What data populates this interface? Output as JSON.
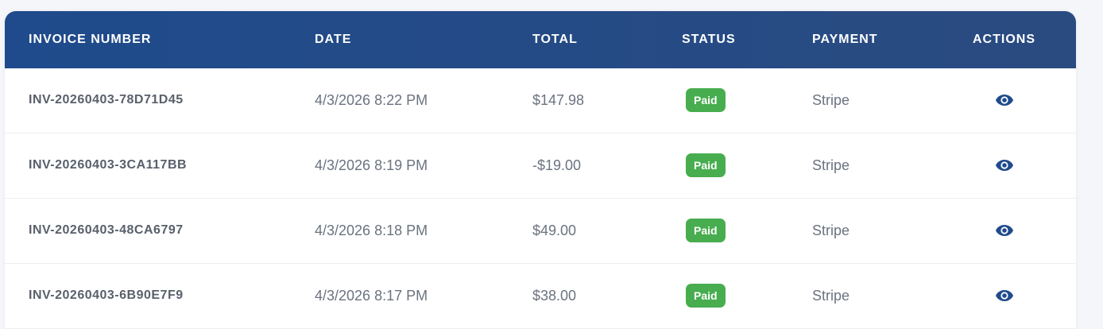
{
  "table": {
    "headers": {
      "invoice_number": "INVOICE NUMBER",
      "date": "DATE",
      "total": "TOTAL",
      "status": "STATUS",
      "payment": "PAYMENT",
      "actions": "ACTIONS"
    },
    "rows": [
      {
        "invoice": "INV-20260403-78D71D45",
        "date": "4/3/2026 8:22 PM",
        "total": "$147.98",
        "status": "Paid",
        "payment": "Stripe",
        "action_icon": "eye-icon"
      },
      {
        "invoice": "INV-20260403-3CA117BB",
        "date": "4/3/2026 8:19 PM",
        "total": "-$19.00",
        "status": "Paid",
        "payment": "Stripe",
        "action_icon": "eye-icon"
      },
      {
        "invoice": "INV-20260403-48CA6797",
        "date": "4/3/2026 8:18 PM",
        "total": "$49.00",
        "status": "Paid",
        "payment": "Stripe",
        "action_icon": "eye-icon"
      },
      {
        "invoice": "INV-20260403-6B90E7F9",
        "date": "4/3/2026 8:17 PM",
        "total": "$38.00",
        "status": "Paid",
        "payment": "Stripe",
        "action_icon": "eye-icon"
      }
    ]
  },
  "colors": {
    "header_bg": "#1f4b8c",
    "status_paid": "#47ad4f",
    "eye_icon": "#1f4b8c"
  }
}
